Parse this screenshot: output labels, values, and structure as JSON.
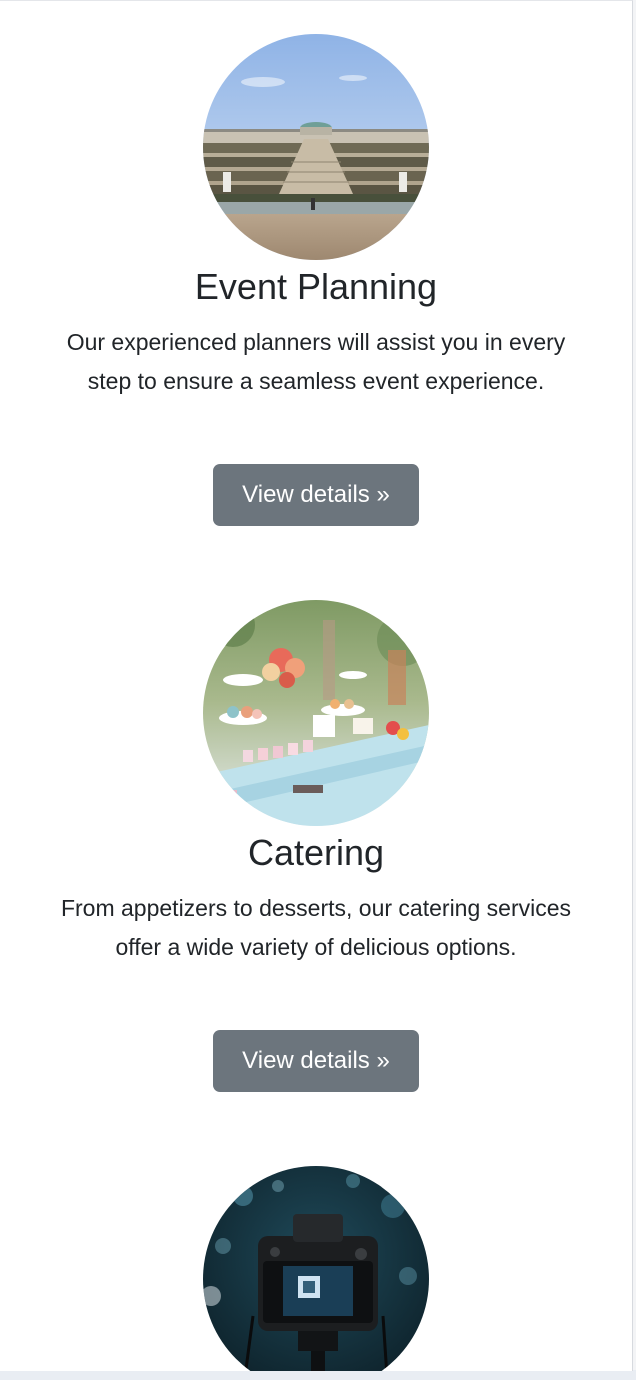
{
  "services": [
    {
      "title": "Event Planning",
      "description": "Our experienced planners will assist you in every step to ensure a seamless event experience.",
      "button_label": "View details »",
      "image": "palace-terraces-photo"
    },
    {
      "title": "Catering",
      "description": "From appetizers to desserts, our catering services offer a wide variety of delicious options.",
      "button_label": "View details »",
      "image": "dessert-buffet-photo"
    },
    {
      "image": "camera-photo"
    }
  ],
  "colors": {
    "button_bg": "#6c757d",
    "button_text": "#ffffff",
    "text": "#212529",
    "page_bg": "#ffffff"
  }
}
